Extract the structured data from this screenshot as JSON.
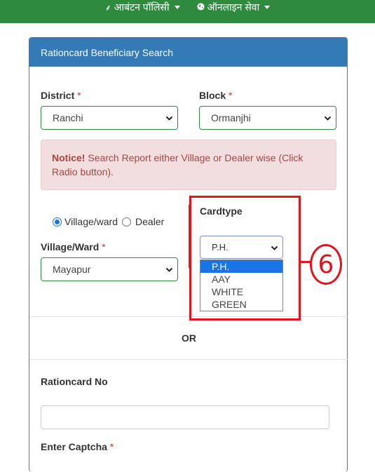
{
  "topnav": {
    "items": [
      {
        "label": "आबंटन पॉलिसी",
        "icon": "wheat-icon"
      },
      {
        "label": "ऑनलाइन सेवा",
        "icon": "globe-icon"
      }
    ]
  },
  "panel": {
    "title": "Rationcard Beneficiary Search",
    "district": {
      "label": "District",
      "required": "*",
      "value": "Ranchi"
    },
    "block": {
      "label": "Block",
      "required": "*",
      "value": "Ormanjhi"
    },
    "notice": {
      "strong": "Notice!",
      "text": " Search Report either Village or Dealer wise (Click Radio button)."
    },
    "search_mode": {
      "options": [
        "Village/ward",
        "Dealer"
      ],
      "selected": "Village/ward"
    },
    "village": {
      "label": "Village/Ward",
      "required": "*",
      "value": "Mayapur"
    },
    "cardtype": {
      "label": "Cardtype",
      "value": "P.H.",
      "options": [
        "P.H.",
        "AAY",
        "WHITE",
        "GREEN"
      ],
      "highlighted": "P.H."
    },
    "or_label": "OR",
    "rationcard_no": {
      "label": "Rationcard No",
      "value": ""
    },
    "captcha": {
      "label": "Enter Captcha",
      "required": "*"
    }
  },
  "annotation": {
    "number": "6",
    "color": "#e3141c"
  },
  "colors": {
    "nav": "#2e8b3e",
    "panel_heading": "#337ab7",
    "select_border": "#2e8b3e",
    "notice_bg": "#f2dede",
    "notice_text": "#a94442"
  }
}
